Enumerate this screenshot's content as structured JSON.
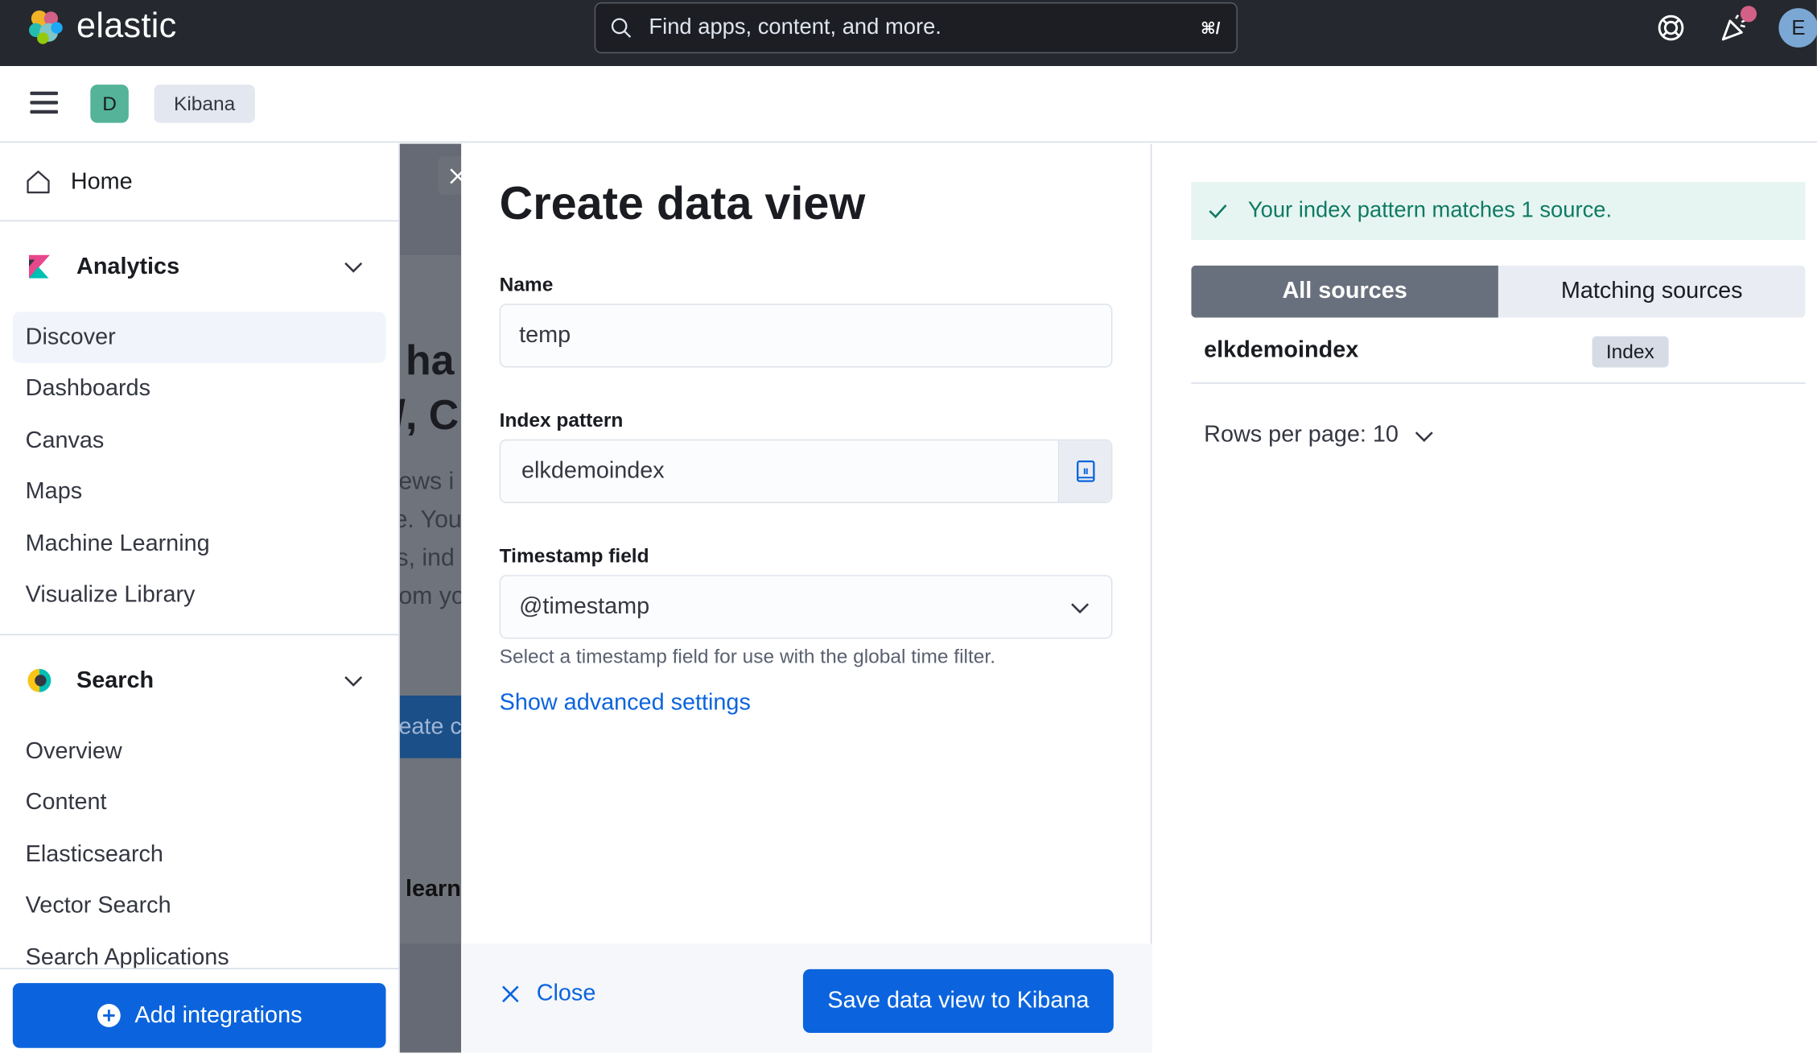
{
  "header": {
    "brand": "elastic",
    "search_placeholder": "Find apps, content, and more.",
    "search_shortcut": "⌘/",
    "user_initial": "E"
  },
  "subbar": {
    "space_initial": "D",
    "breadcrumb": "Kibana"
  },
  "background_page": {
    "title_line1": "ha",
    "title_line2": "/, Cl",
    "text_lines": [
      "ews i",
      "e. You",
      "s, ind",
      "om yo"
    ],
    "button": "eate c",
    "learn": "learn"
  },
  "nav": {
    "home": "Home",
    "sections": [
      {
        "title": "Analytics",
        "items": [
          "Discover",
          "Dashboards",
          "Canvas",
          "Maps",
          "Machine Learning",
          "Visualize Library"
        ]
      },
      {
        "title": "Search",
        "items": [
          "Overview",
          "Content",
          "Elasticsearch",
          "Vector Search",
          "Search Applications"
        ]
      }
    ],
    "add_integrations": "Add integrations"
  },
  "flyout": {
    "title": "Create data view",
    "name_label": "Name",
    "name_value": "temp",
    "index_label": "Index pattern",
    "index_value": "elkdemoindex",
    "timestamp_label": "Timestamp field",
    "timestamp_value": "@timestamp",
    "timestamp_help": "Select a timestamp field for use with the global time filter.",
    "advanced_link": "Show advanced settings",
    "close_label": "Close",
    "save_label": "Save data view to Kibana"
  },
  "sources": {
    "callout": "Your index pattern matches 1 source.",
    "tab_all": "All sources",
    "tab_matching": "Matching sources",
    "rows": [
      {
        "name": "elkdemoindex",
        "type": "Index"
      }
    ],
    "rows_per_page": "Rows per page: 10"
  },
  "colors": {
    "header_bg": "#25282f",
    "primary": "#0b64dd",
    "success_text": "#0f7a64",
    "success_bg": "#e6f5f1"
  }
}
